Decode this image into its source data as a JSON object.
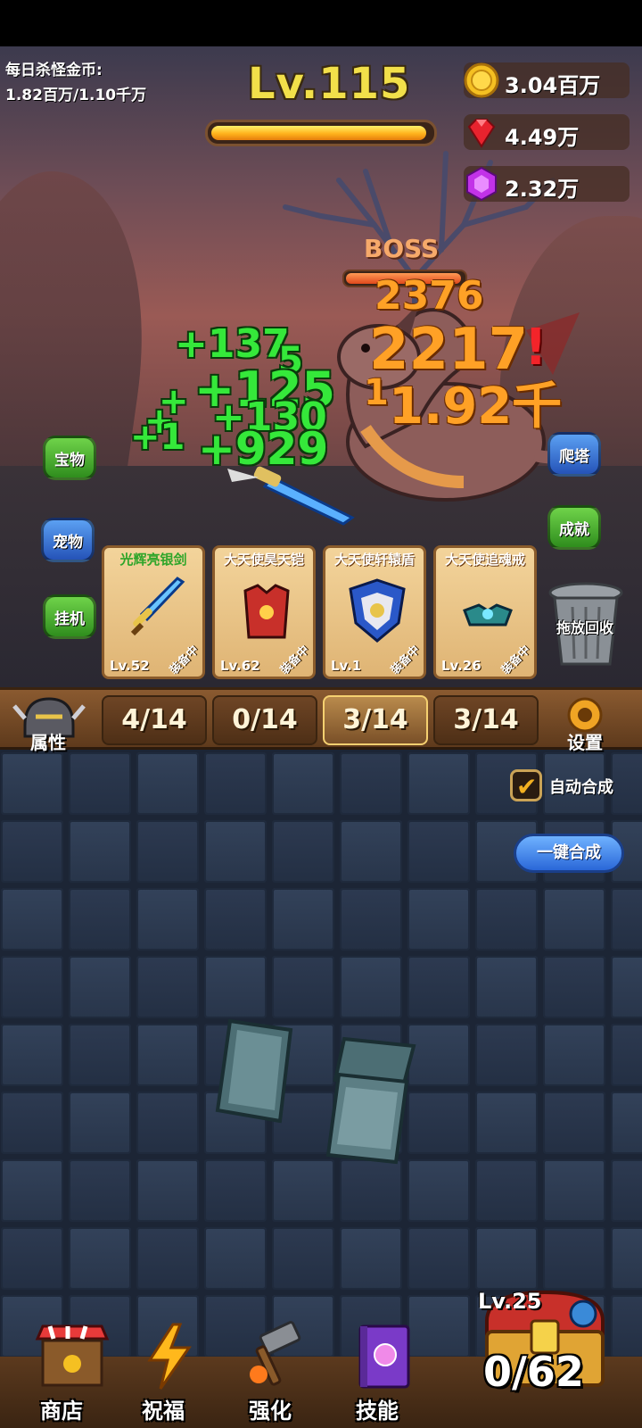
{
  "hud": {
    "daily_gold_label": "每日杀怪金币:",
    "daily_gold_value": "1.82百万/1.10千万",
    "player_level": "Lv.115",
    "xp_progress": 0.98,
    "currencies": {
      "gold": "3.04百万",
      "ruby": "4.49万",
      "gem": "2.32万"
    }
  },
  "boss": {
    "label": "BOSS",
    "hp_progress": 0.98
  },
  "damage_numbers": {
    "green": [
      "+137",
      "5",
      "+125",
      "+",
      "+",
      "+1",
      "+130",
      "+929"
    ],
    "orange": [
      "2376",
      "2217",
      "1",
      "1.92千"
    ],
    "red": [
      "!"
    ]
  },
  "side_buttons": {
    "treasure": "宝物",
    "pet": "宠物",
    "idle": "挂机",
    "tower": "爬塔",
    "achievement": "成就"
  },
  "equipment": [
    {
      "name": "光辉亮银剑",
      "level": "Lv.52",
      "status": "装备中",
      "color": "#2fa52a"
    },
    {
      "name": "大天使昊天铠",
      "level": "Lv.62",
      "status": "装备中",
      "color": "#ffffff"
    },
    {
      "name": "大天使轩辕盾",
      "level": "Lv.1",
      "status": "装备中",
      "color": "#ffffff"
    },
    {
      "name": "大天使追魂戒",
      "level": "Lv.26",
      "status": "装备中",
      "color": "#ffffff"
    }
  ],
  "trash_label": "拖放回收",
  "tabs": {
    "attributes": "属性",
    "counts": [
      "4/14",
      "0/14",
      "3/14",
      "3/14"
    ],
    "active_index": 2,
    "settings": "设置"
  },
  "merge": {
    "auto_label": "自动合成",
    "auto_enabled": true,
    "merge_all": "一键合成"
  },
  "bottom_nav": {
    "shop": "商店",
    "bless": "祝福",
    "enhance": "强化",
    "skills": "技能"
  },
  "chest": {
    "level": "Lv.25",
    "count": "0/62"
  }
}
